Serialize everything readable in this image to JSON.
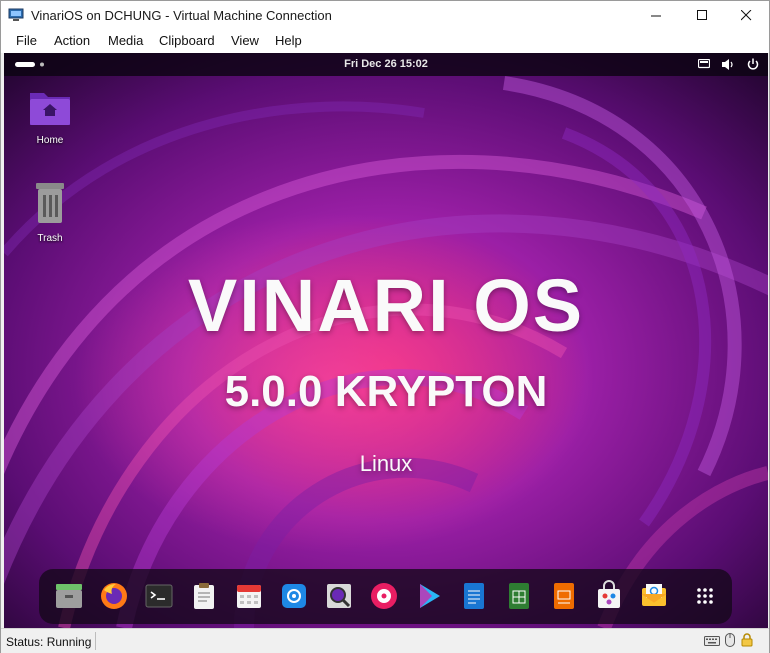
{
  "window": {
    "title": "VinariOS on DCHUNG - Virtual Machine Connection",
    "minimize_icon": "minimize-icon",
    "maximize_icon": "maximize-icon",
    "close_icon": "close-icon"
  },
  "menu": [
    "File",
    "Action",
    "Media",
    "Clipboard",
    "View",
    "Help"
  ],
  "topbar": {
    "clock": "Fri Dec 26  15:02"
  },
  "desktop": {
    "icons": [
      {
        "label": "Home",
        "icon": "home-folder-icon"
      },
      {
        "label": "Trash",
        "icon": "trash-icon"
      }
    ],
    "headline": "VINARI OS",
    "version": "5.0.0 KRYPTON",
    "subtitle": "Linux"
  },
  "dock": [
    "archive-manager-icon",
    "firefox-icon",
    "terminal-icon",
    "clipboard-notes-icon",
    "calendar-icon",
    "email-client-icon",
    "image-viewer-icon",
    "music-player-icon",
    "media-player-icon",
    "writer-icon",
    "spreadsheet-icon",
    "presentation-icon",
    "software-store-icon",
    "mail-icon",
    "app-grid-icon"
  ],
  "statusbar": {
    "status": "Status: Running"
  },
  "colors": {
    "wallpaper_primary": "#7a128f",
    "wallpaper_accent": "#e0257a",
    "topbar": "#0c0412"
  }
}
